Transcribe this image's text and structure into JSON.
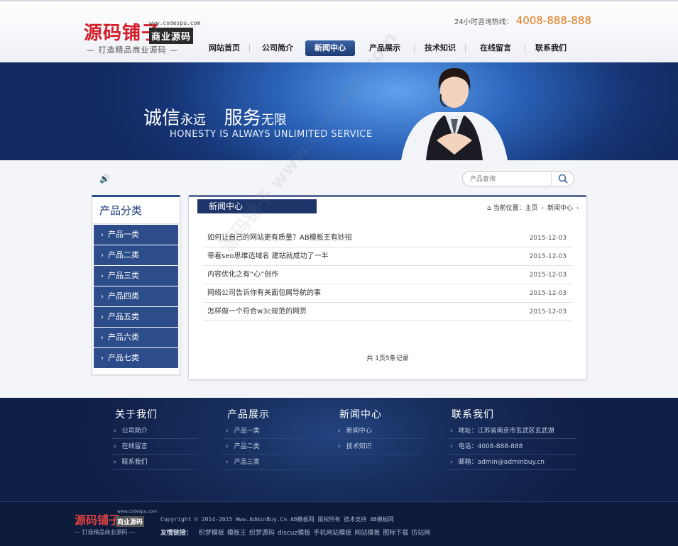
{
  "header": {
    "logo": {
      "main": "源码铺子",
      "badge": "商业源码",
      "url": "www.codespu.com",
      "slogan": "— 打造精品商业源码 —"
    },
    "hotline_label": "24小时咨询热线：",
    "hotline_number": "4008-888-888"
  },
  "nav": [
    {
      "label": "网站首页",
      "w": 72
    },
    {
      "label": "公司简介",
      "w": 78
    },
    {
      "label": "新闻中心",
      "w": 70,
      "active": true
    },
    {
      "label": "产品展示",
      "w": 84
    },
    {
      "label": "技术知识",
      "w": 72
    },
    {
      "label": "在线留言",
      "w": 84
    },
    {
      "label": "联系我们",
      "w": 72
    }
  ],
  "banner": {
    "word1": "诚信",
    "word2": "永远",
    "word3": "服务",
    "word4": "无限",
    "english": "HONESTY IS ALWAYS UNLIMITED SERVICE"
  },
  "search": {
    "placeholder": "产品查询"
  },
  "sidebar": {
    "title": "产品分类",
    "items": [
      "产品一类",
      "产品二类",
      "产品三类",
      "产品四类",
      "产品五类",
      "产品六类",
      "产品七类"
    ]
  },
  "main": {
    "tab": "新闻中心",
    "breadcrumb": {
      "label": "当前位置：",
      "home": "主页",
      "current": "新闻中心"
    },
    "news": [
      {
        "title": "如何让自己的网站更有质量？AB模板王有妙招",
        "date": "2015-12-03"
      },
      {
        "title": "带着seo思维选域名 建站就成功了一半",
        "date": "2015-12-03"
      },
      {
        "title": "内容优化之有“心”创作",
        "date": "2015-12-03"
      },
      {
        "title": "网络公司告诉你有关面包屑导航的事",
        "date": "2015-12-03"
      },
      {
        "title": "怎样做一个符合w3c规范的网页",
        "date": "2015-12-03"
      }
    ],
    "pager": "共 1页5条记录"
  },
  "footer": {
    "columns": [
      {
        "title": "关于我们",
        "items": [
          "公司简介",
          "在线留言",
          "联系我们"
        ]
      },
      {
        "title": "产品展示",
        "items": [
          "产品一类",
          "产品二类",
          "产品三类"
        ]
      },
      {
        "title": "新闻中心",
        "items": [
          "新闻中心",
          "技术知识"
        ]
      },
      {
        "title": "联系我们",
        "items": [
          "地址：江苏省南京市玄武区玄武湖",
          "电话：4008-888-888",
          "邮箱：admin@adminbuy.cn"
        ]
      }
    ],
    "logo": {
      "main": "源码铺子",
      "badge": "商业源码",
      "url": "www.codespu.com",
      "slogan": "— 打造精品商业源码 —"
    },
    "copyright": "Copyright © 2014-2015 Www.AdminBuy.Cn AB模板网 版权所有  技术支持 AB模板网",
    "links_label": "友情链接：",
    "links": [
      "织梦模板",
      "模板王",
      "织梦源码",
      "discuz模板",
      "手机网站模板",
      "网站模板",
      "图标下载",
      "仿站网"
    ]
  },
  "watermark": "源码铺子 www.codespu.com",
  "colors": {
    "brand_navy": "#1d3569",
    "accent_orange": "#e07a1a",
    "logo_red": "#d21f2b"
  }
}
